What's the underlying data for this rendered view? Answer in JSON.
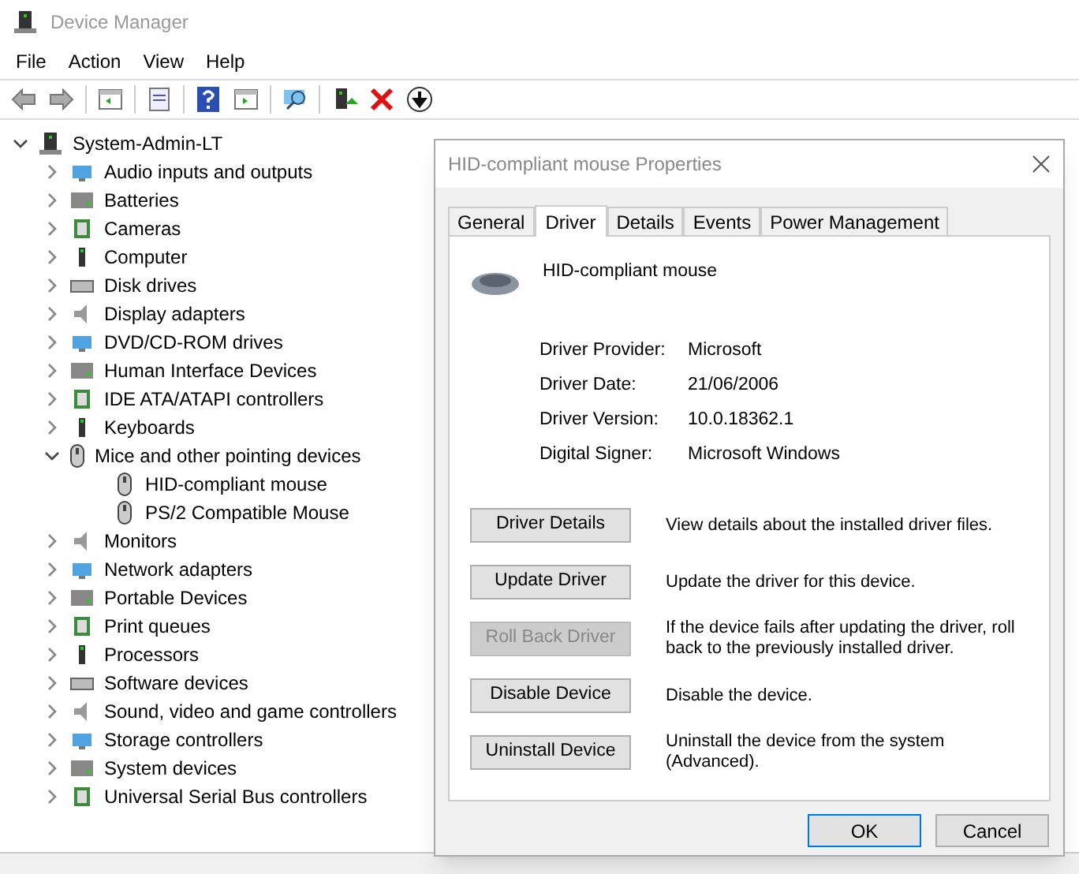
{
  "window": {
    "title": "Device Manager"
  },
  "menu": [
    "File",
    "Action",
    "View",
    "Help"
  ],
  "tree": {
    "label": "System-Admin-LT",
    "expanded": true,
    "children": [
      {
        "label": "Audio inputs and outputs",
        "expanded": false
      },
      {
        "label": "Batteries",
        "expanded": false
      },
      {
        "label": "Cameras",
        "expanded": false
      },
      {
        "label": "Computer",
        "expanded": false
      },
      {
        "label": "Disk drives",
        "expanded": false
      },
      {
        "label": "Display adapters",
        "expanded": false
      },
      {
        "label": "DVD/CD-ROM drives",
        "expanded": false
      },
      {
        "label": "Human Interface Devices",
        "expanded": false
      },
      {
        "label": "IDE ATA/ATAPI controllers",
        "expanded": false
      },
      {
        "label": "Keyboards",
        "expanded": false
      },
      {
        "label": "Mice and other pointing devices",
        "expanded": true,
        "children": [
          {
            "label": "HID-compliant mouse"
          },
          {
            "label": "PS/2 Compatible Mouse"
          }
        ]
      },
      {
        "label": "Monitors",
        "expanded": false
      },
      {
        "label": "Network adapters",
        "expanded": false
      },
      {
        "label": "Portable Devices",
        "expanded": false
      },
      {
        "label": "Print queues",
        "expanded": false
      },
      {
        "label": "Processors",
        "expanded": false
      },
      {
        "label": "Software devices",
        "expanded": false
      },
      {
        "label": "Sound, video and game controllers",
        "expanded": false
      },
      {
        "label": "Storage controllers",
        "expanded": false
      },
      {
        "label": "System devices",
        "expanded": false
      },
      {
        "label": "Universal Serial Bus controllers",
        "expanded": false
      }
    ]
  },
  "dialog": {
    "title": "HID-compliant mouse Properties",
    "tabs": [
      {
        "label": "General",
        "selected": false
      },
      {
        "label": "Driver",
        "selected": true
      },
      {
        "label": "Details",
        "selected": false
      },
      {
        "label": "Events",
        "selected": false
      },
      {
        "label": "Power Management",
        "selected": false
      }
    ],
    "device_name": "HID-compliant mouse",
    "properties": [
      {
        "label": "Driver Provider:",
        "value": "Microsoft"
      },
      {
        "label": "Driver Date:",
        "value": "21/06/2006"
      },
      {
        "label": "Driver Version:",
        "value": "10.0.18362.1"
      },
      {
        "label": "Digital Signer:",
        "value": "Microsoft Windows"
      }
    ],
    "actions": [
      {
        "label": "Driver Details",
        "description": "View details about the installed driver files.",
        "disabled": false
      },
      {
        "label": "Update Driver",
        "description": "Update the driver for this device.",
        "disabled": false
      },
      {
        "label": "Roll Back Driver",
        "description": "If the device fails after updating the driver, roll back to the previously installed driver.",
        "disabled": true
      },
      {
        "label": "Disable Device",
        "description": "Disable the device.",
        "disabled": false
      },
      {
        "label": "Uninstall Device",
        "description": "Uninstall the device from the system (Advanced).",
        "disabled": false
      }
    ],
    "buttons": [
      "OK",
      "Cancel"
    ]
  }
}
